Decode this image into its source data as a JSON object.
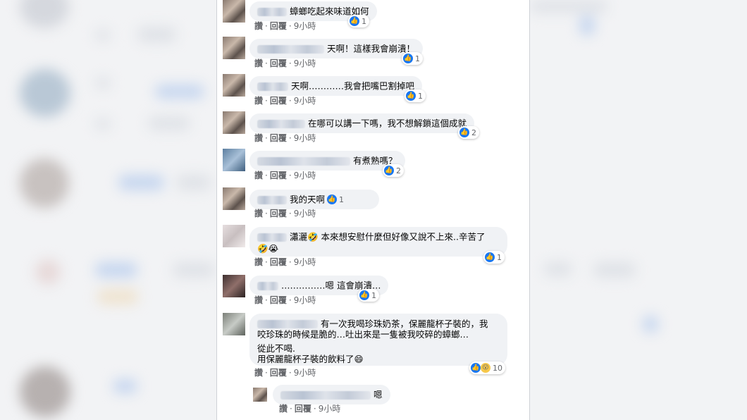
{
  "actions": {
    "like": "讚",
    "reply": "回覆",
    "time": "9小時",
    "dot": "·"
  },
  "comments": [
    {
      "text": "蟑螂吃起來味道如何",
      "reactions": "1"
    },
    {
      "text": "天啊！這樣我會崩潰！",
      "reactions": "1"
    },
    {
      "text": "天啊…………我會把嘴巴割掉吧",
      "reactions": "1"
    },
    {
      "text": "在哪可以講一下嗎，我不想解鎖這個成就",
      "reactions": "2"
    },
    {
      "text": "有煮熟嗎？",
      "reactions": "2"
    },
    {
      "text": "我的天啊",
      "reactions": "1"
    },
    {
      "text": "瀟灑🤣 本來想安慰什麼但好像又說不上來..辛苦了",
      "text2": "🤣😭",
      "reactions": "1"
    },
    {
      "text": "……………嗯 這會崩潰…",
      "reactions": "1"
    },
    {
      "text": "有一次我喝珍珠奶茶，保麗龍杯子裝的，我",
      "text2": "咬珍珠的時候是脆的…吐出來是一隻被我咬碎的蟑螂…",
      "text3": "從此不喝.",
      "text4": "用保麗龍杯子裝的飲料了😄",
      "reactions": "10"
    },
    {
      "text": "嗯"
    }
  ]
}
